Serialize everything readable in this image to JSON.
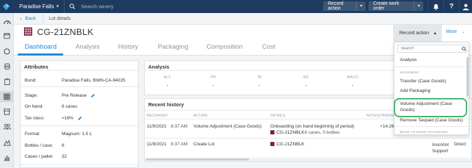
{
  "topbar": {
    "winery": "Paradise Falls",
    "search_placeholder": "Search winery",
    "record_action": "Record action",
    "create_work_order": "Create work order"
  },
  "breadcrumb": {
    "back": "Back",
    "current": "Lot details"
  },
  "lot": {
    "code": "CG-21ZNBLK",
    "icon_color": "#7a2344"
  },
  "tabs": [
    "Dashboard",
    "Analysis",
    "History",
    "Packaging",
    "Composition",
    "Cost"
  ],
  "header_actions": {
    "record_action": "Record action",
    "more": "More"
  },
  "attributes": {
    "title": "Attributes",
    "rows": [
      {
        "key": "Bond:",
        "value": "Paradise Falls, BWN-CA-94025"
      },
      {
        "key": "Stage:",
        "value": "Pre Release"
      },
      {
        "key": "On hand:",
        "value": "6 cases"
      },
      {
        "key": "Tax class:",
        "value": "<16%"
      },
      {
        "key": "Format:",
        "value": "Magnum: 1.5 L"
      },
      {
        "key": "Bottles / case:",
        "value": "6"
      },
      {
        "key": "Cases / pallet:",
        "value": "32"
      }
    ]
  },
  "analysis": {
    "title": "Analysis",
    "columns": [
      {
        "label": "ALC",
        "value": "-"
      },
      {
        "label": "PH",
        "value": "-"
      },
      {
        "label": "TA",
        "value": "-"
      },
      {
        "label": "RS",
        "value": "-"
      },
      {
        "label": "MALIC",
        "value": "-"
      }
    ]
  },
  "history": {
    "title": "Recent history",
    "headers": [
      "RECORDED",
      "ACTION",
      "DETAILS",
      "NOTES",
      "CHANGE"
    ],
    "rows": [
      {
        "date": "11/9/2021",
        "time": "8:37 AM",
        "action": "Volume Adjustment (Case Goods)",
        "details_line1": "Onboarding (on hand beginning of period)",
        "lot": "CG-21ZNBLK",
        "details_line2": "6 cases, 0 bottles",
        "change": "+14.26"
      },
      {
        "date": "11/9/2021",
        "time": "8:37 AM",
        "action": "Create Lot",
        "lot": "CG-21ZNBLK",
        "user": "InnoVint Support",
        "type": "Direct"
      }
    ]
  },
  "menu": {
    "search_placeholder": "Search",
    "items": {
      "analysis": "Analysis",
      "movement_header": "MOVEMENT",
      "transfer": "Transfer (Case Goods)",
      "add_packaging": "Add Packaging",
      "volume_adjustment": "Volume Adjustment (Case Goods)",
      "remove_taxpaid": "Remove Taxpaid (Case Goods)",
      "bond_header": "BOND TO BOND TRANSFERS"
    }
  },
  "colors": {
    "brand_dark": "#1e3a5f",
    "accent": "#1f88d6",
    "highlight": "#47b36a"
  }
}
